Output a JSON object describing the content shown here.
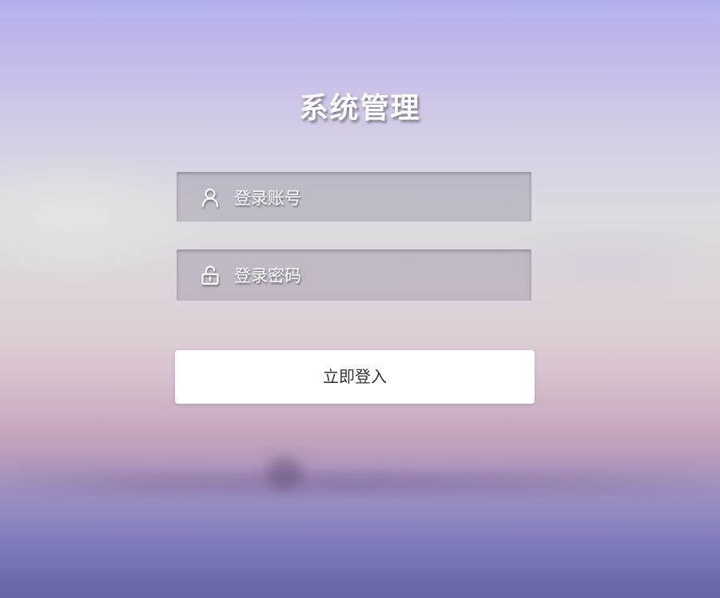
{
  "page": {
    "title": "系统管理"
  },
  "form": {
    "username": {
      "placeholder": "登录账号",
      "icon": "user-icon"
    },
    "password": {
      "placeholder": "登录密码",
      "icon": "lock-icon"
    },
    "submit_label": "立即登入"
  },
  "colors": {
    "button_bg": "#ffffff",
    "button_text": "#333333",
    "field_bg": "#a098a8",
    "title_text": "#ffffff"
  }
}
